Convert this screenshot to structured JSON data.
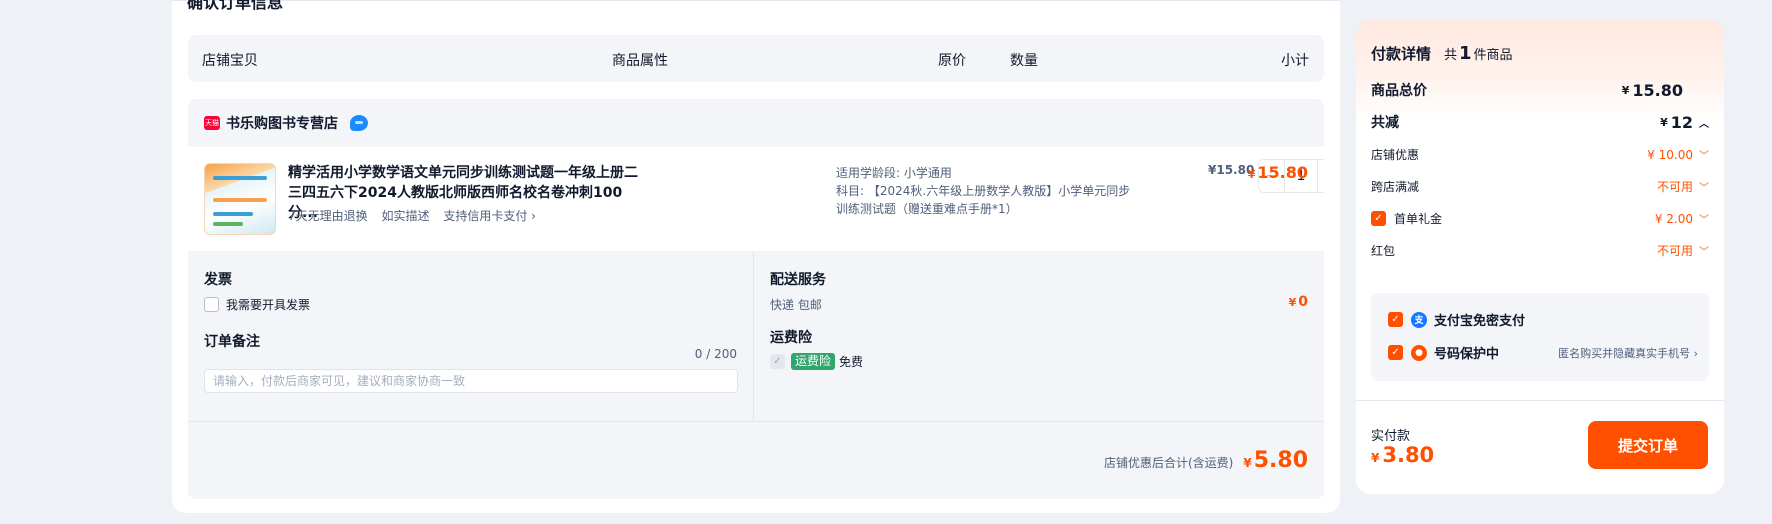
{
  "order": {
    "title": "确认订单信息",
    "columns": {
      "item": "店铺宝贝",
      "attrs": "商品属性",
      "price": "原价",
      "qty": "数量",
      "subtotal": "小计"
    },
    "shop": {
      "badge": "天猫",
      "name": "书乐购图书专营店"
    },
    "item": {
      "title": "精学活用小学数学语文单元同步训练测试题一年级上册二三四五六下2024人教版北师版西师名校名卷冲刺100分...",
      "tags": [
        "7天无理由退换",
        "如实描述",
        "支持信用卡支付 ›"
      ],
      "attr_line1": "适用学龄段: 小学通用",
      "attr_line2": "科目: 【2024秋.六年级上册数学人教版】小学单元同步训练测试题（赠送重难点手册*1）",
      "unit_price": "¥15.80",
      "qty_minus": "−",
      "qty": "1",
      "qty_plus": "+",
      "subtotal_currency": "¥",
      "subtotal": "15.80"
    },
    "invoice": {
      "title": "发票",
      "checkbox_label": "我需要开具发票"
    },
    "remark": {
      "title": "订单备注",
      "counter": "0 / 200",
      "placeholder": "请输入，付款后商家可见，建议和商家协商一致"
    },
    "delivery": {
      "title": "配送服务",
      "method": "快递 包邮",
      "fee_currency": "¥",
      "fee": "0"
    },
    "insurance": {
      "title": "运费险",
      "badge": "运费险",
      "status": "免费"
    },
    "total": {
      "label": "店铺优惠后合计(含运费)",
      "currency": "¥",
      "amount": "5.80"
    }
  },
  "payment": {
    "title": "付款详情",
    "count_prefix": "共",
    "count": "1",
    "count_suffix": "件商品",
    "goods_total_label": "商品总价",
    "goods_total_currency": "¥",
    "goods_total": "15.80",
    "discount_label": "共减",
    "discount_currency": "¥",
    "discount": "12",
    "lines": [
      {
        "label": "店铺优惠",
        "value": "¥ 10.00"
      },
      {
        "label": "跨店满减",
        "value": "不可用"
      },
      {
        "label": "首单礼金",
        "value": "¥ 2.00"
      },
      {
        "label": "红包",
        "value": "不可用"
      }
    ],
    "services": [
      {
        "label": "支付宝免密支付",
        "hint": ""
      },
      {
        "label": "号码保护中",
        "hint": "匿名购买并隐藏真实手机号 ›"
      }
    ],
    "actual_label": "实付款",
    "actual_currency": "¥",
    "actual_amount": "3.80",
    "submit_label": "提交订单"
  },
  "colors": {
    "accent": "#ff5000",
    "text": "#11192d",
    "muted": "#50607a",
    "panel_bg": "#f3f5f8",
    "insurance_green": "#31a66b",
    "alipay_blue": "#1677ff"
  },
  "icons": [
    "tmall-badge",
    "chat-icon",
    "check-icon",
    "chevron-down-icon",
    "chevron-up-icon",
    "alipay-icon",
    "shield-icon",
    "chevron-right-icon"
  ]
}
